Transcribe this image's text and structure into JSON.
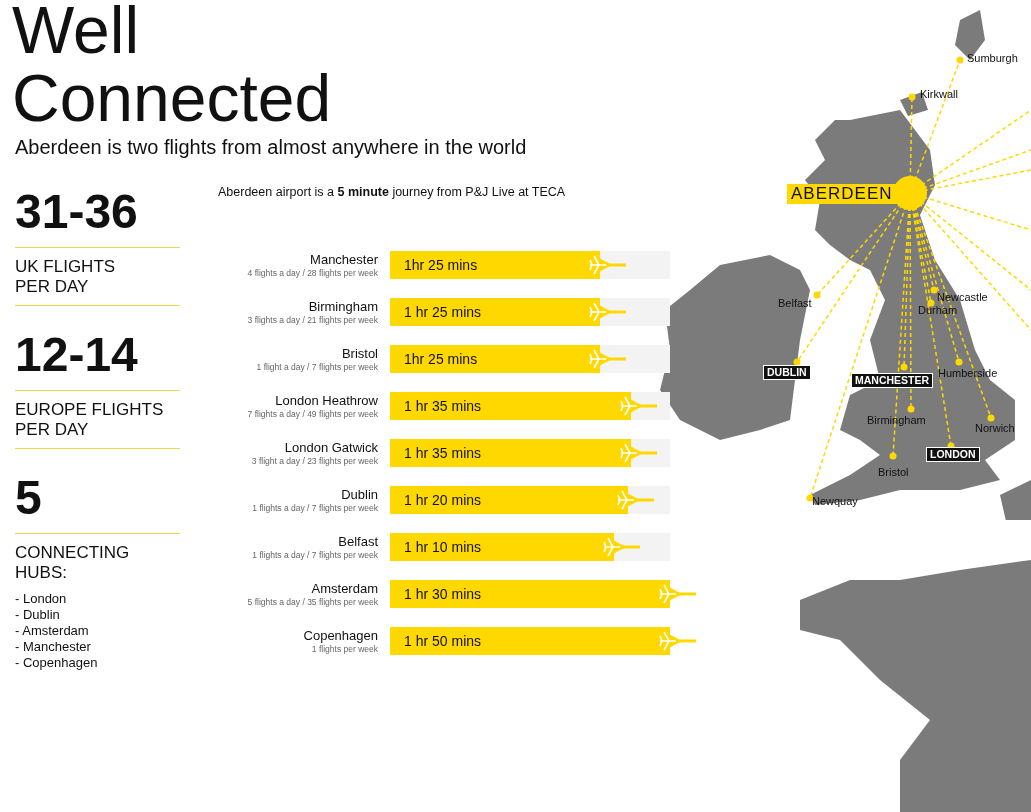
{
  "title": [
    "Well",
    "Connected"
  ],
  "subtitle": "Aberdeen is two flights from almost anywhere in the world",
  "note": "Aberdeen airport is a **5 minute** journey from P&J Live at TECA",
  "stats": [
    {
      "value": "31-36",
      "label": [
        "UK FLIGHTS",
        "PER DAY"
      ]
    },
    {
      "value": "12-14",
      "label": [
        "EUROPE FLIGHTS",
        "PER DAY"
      ]
    },
    {
      "value": "5",
      "label": [
        "CONNECTING",
        "HUBS:"
      ],
      "list": [
        "- London",
        "- Dublin",
        "- Amsterdam",
        "- Manchester",
        "- Copenhagen"
      ]
    }
  ],
  "flights": [
    {
      "city": "Manchester",
      "frequency": "4 flights a day / 28 flights per week",
      "duration": "1hr 25 mins",
      "level": 0.75
    },
    {
      "city": "Birmingham",
      "frequency": "3 flights a day / 21 flights per week",
      "duration": "1 hr 25 mins",
      "level": 0.75
    },
    {
      "city": "Bristol",
      "frequency": "1 flight a day / 7 flights per week",
      "duration": "1hr 25 mins",
      "level": 0.75
    },
    {
      "city": "London Heathrow",
      "frequency": "7 flights a day / 49 flights per week",
      "duration": "1 hr 35 mins",
      "level": 0.86
    },
    {
      "city": "London Gatwick",
      "frequency": "3 flight a day / 23 flights per week",
      "duration": "1 hr 35 mins",
      "level": 0.86
    },
    {
      "city": "Dublin",
      "frequency": "1 flights a day / 7 flights per week",
      "duration": "1 hr 20 mins",
      "level": 0.85
    },
    {
      "city": "Belfast",
      "frequency": "1 flights a day / 7 flights per week",
      "duration": "1 hr 10 mins",
      "level": 0.8
    },
    {
      "city": "Amsterdam",
      "frequency": "5 flights a day / 35 flights per week",
      "duration": "1 hr 30 mins",
      "level": 1
    },
    {
      "city": "Copenhagen",
      "frequency": "1 flights per week",
      "duration": "1 hr 50 mins",
      "level": 1
    }
  ],
  "map": {
    "cities": [
      {
        "name": "Sumburgh",
        "kind": "city"
      },
      {
        "name": "Kirkwall",
        "kind": "city"
      },
      {
        "name": "ABERDEEN",
        "kind": "origin"
      },
      {
        "name": "Belfast",
        "kind": "city"
      },
      {
        "name": "Newcastle",
        "kind": "city"
      },
      {
        "name": "Durham",
        "kind": "city"
      },
      {
        "name": "DUBLIN",
        "kind": "hub"
      },
      {
        "name": "MANCHESTER",
        "kind": "hub"
      },
      {
        "name": "Humberside",
        "kind": "city"
      },
      {
        "name": "Birmingham",
        "kind": "city"
      },
      {
        "name": "Norwich",
        "kind": "city"
      },
      {
        "name": "LONDON",
        "kind": "hub"
      },
      {
        "name": "Bristol",
        "kind": "city"
      },
      {
        "name": "Newquay",
        "kind": "city"
      }
    ]
  }
}
